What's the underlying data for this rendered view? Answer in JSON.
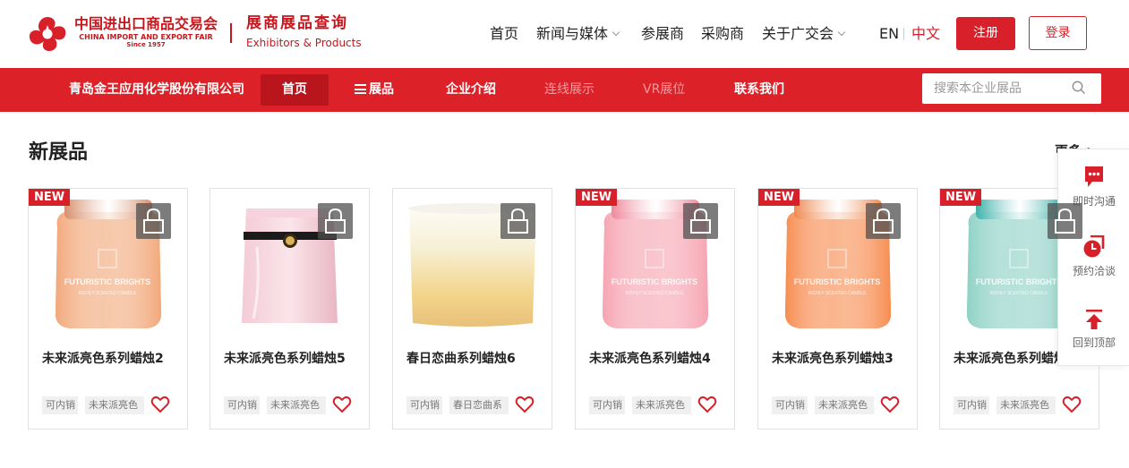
{
  "header": {
    "logo": {
      "cn": "中国进出口商品交易会",
      "en": "CHINA IMPORT AND EXPORT FAIR",
      "since": "Since 1957"
    },
    "site_title_cn": "展商展品查询",
    "site_title_en": "Exhibitors & Products",
    "nav": [
      {
        "label": "首页",
        "has_dropdown": false
      },
      {
        "label": "新闻与媒体",
        "has_dropdown": true
      },
      {
        "label": "参展商",
        "has_dropdown": false
      },
      {
        "label": "采购商",
        "has_dropdown": false
      },
      {
        "label": "关于广交会",
        "has_dropdown": true
      }
    ],
    "lang_en": "EN",
    "lang_cn": "中文",
    "register_label": "注册",
    "login_label": "登录"
  },
  "company_bar": {
    "company_name": "青岛金王应用化学股份有限公司",
    "nav": [
      {
        "label": "首页",
        "state": "active"
      },
      {
        "label": "展品",
        "state": "normal"
      },
      {
        "label": "企业介绍",
        "state": "normal"
      },
      {
        "label": "连线展示",
        "state": "disabled"
      },
      {
        "label": "VR展位",
        "state": "disabled"
      },
      {
        "label": "联系我们",
        "state": "normal"
      }
    ],
    "search_placeholder": "搜索本企业展品"
  },
  "section": {
    "title": "新展品",
    "more_label": "更多 >"
  },
  "products": [
    {
      "name": "未来派亮色系列蜡烛2",
      "is_new": true,
      "locked": true,
      "tags": [
        "可内销",
        "未来派亮色"
      ],
      "image": "peach-candle-jar",
      "colors": {
        "lid": "#d88f6e",
        "body": "#f2a87a"
      }
    },
    {
      "name": "未来派亮色系列蜡烛5",
      "is_new": false,
      "locked": true,
      "tags": [
        "可内销",
        "未来派亮色"
      ],
      "image": "pink-glass-candle",
      "colors": {
        "lid": "#e8a5b5",
        "body": "#f0c8d2"
      }
    },
    {
      "name": "春日恋曲系列蜡烛6",
      "is_new": false,
      "locked": true,
      "tags": [
        "可内销",
        "春日恋曲系"
      ],
      "image": "yellow-glass-candle",
      "colors": {
        "lid": "#f4f1e6",
        "body": "#f3dca0"
      }
    },
    {
      "name": "未来派亮色系列蜡烛4",
      "is_new": true,
      "locked": true,
      "tags": [
        "可内销",
        "未来派亮色"
      ],
      "image": "pink-candle-jar",
      "colors": {
        "lid": "#ef8a9c",
        "body": "#f6a4b1"
      }
    },
    {
      "name": "未来派亮色系列蜡烛3",
      "is_new": true,
      "locked": true,
      "tags": [
        "可内销",
        "未来派亮色"
      ],
      "image": "orange-candle-jar",
      "colors": {
        "lid": "#f08a52",
        "body": "#f78c50"
      }
    },
    {
      "name": "未来派亮色系列蜡烛",
      "is_new": true,
      "locked": true,
      "tags": [
        "可内销",
        "未来派亮色"
      ],
      "image": "teal-candle-jar",
      "colors": {
        "lid": "#3fb2ab",
        "body": "#8ed1c5"
      }
    }
  ],
  "badges": {
    "new_label": "NEW"
  },
  "jar_label": {
    "brand": "FUTURISTIC BRIGHTS",
    "sub": "RICHLY SCENTED CANDLE"
  },
  "float_panel": {
    "chat_label": "即时沟通",
    "appointment_label": "预约洽谈",
    "top_label": "回到顶部"
  },
  "colors": {
    "brand_red": "#dc2129",
    "active_nav_bg": "#b8151c",
    "disabled_nav_text": "#f39a9e"
  }
}
